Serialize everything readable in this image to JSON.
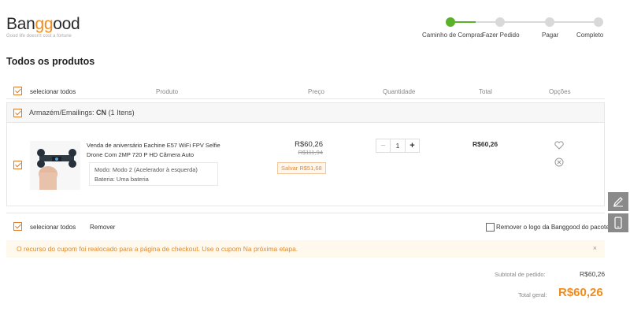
{
  "brand": {
    "logo_part1": "Ban",
    "logo_part2": "gg",
    "logo_part3": "ood",
    "tagline": "Good life doesn't cost a fortune"
  },
  "steps": [
    {
      "label": "Caminho de Compras",
      "active": true
    },
    {
      "label": "Fazer Pedido",
      "active": false
    },
    {
      "label": "Pagar",
      "active": false
    },
    {
      "label": "Completo",
      "active": false
    }
  ],
  "page_title": "Todos os produtos",
  "columns": {
    "select_all": "selecionar todos",
    "product": "Produto",
    "price": "Preço",
    "quantity": "Quantidade",
    "total": "Total",
    "options": "Opções"
  },
  "warehouse": {
    "label_prefix": "Armazém/Emailings:",
    "code": "CN",
    "count": "(1 Itens)"
  },
  "product": {
    "name": "Venda de aniversário Eachine E57 WiFi FPV Selfie Drone Com 2MP 720 P HD Câmera Auto",
    "attr_mode": "Modo: Modo 2 (Acelerador à esquerda)",
    "attr_battery": "Bateria: Uma bateria",
    "price": "R$60,26",
    "original_price": "R$111,94",
    "save": "Salvar R$51,68",
    "quantity": "1",
    "total": "R$60,26",
    "qty_minus": "−",
    "qty_plus": "+"
  },
  "footer": {
    "select_all": "selecionar todos",
    "remove": "Remover",
    "remove_logo": "Remover o logo da Banggood do pacote"
  },
  "notice": {
    "text": "O recurso do cupom foi realocado para a página de checkout. Use o cupom Na próxima etapa.",
    "close": "×"
  },
  "summary": {
    "subtotal_label": "Subtotal de pedido:",
    "subtotal_value": "R$60,26",
    "grand_label": "Total geral:",
    "grand_value": "R$60,26"
  },
  "colors": {
    "accent_orange": "#f08c1d",
    "progress_green": "#5ab22a"
  }
}
